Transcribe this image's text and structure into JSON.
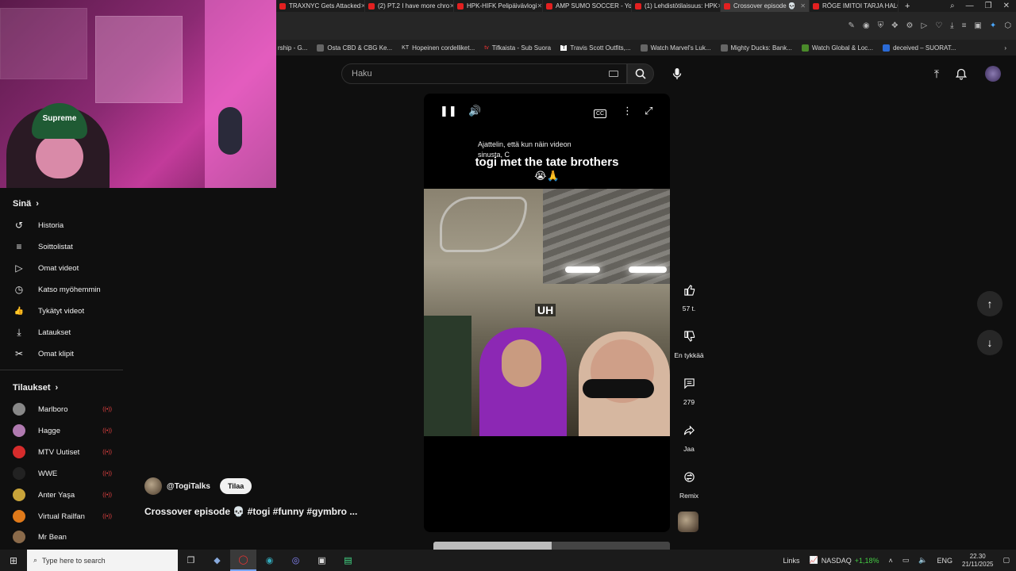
{
  "browser": {
    "tabs": [
      {
        "label": "TRAXNYC Gets Attacked",
        "active": false
      },
      {
        "label": "(2) PT.2 I have more chro",
        "active": false
      },
      {
        "label": "HPK-HIFK Pelipäivävlogi",
        "active": false
      },
      {
        "label": "AMP SUMO SOCCER - Yo",
        "active": false
      },
      {
        "label": "(1) Lehdistötilaisuus: HPK",
        "active": false
      },
      {
        "label": "Crossover episode 💀",
        "active": true
      },
      {
        "label": "RÖGE IMITOI TARJA HALO",
        "active": false
      }
    ],
    "bookmarks": [
      "rship - G...",
      "Osta CBD & CBG Ke...",
      "Hopeinen cordelliket...",
      "Tifkaista - Sub Suora",
      "Travis Scott Outfits,...",
      "Watch Marvel's Luk...",
      "Mighty Ducks: Bank...",
      "Watch Global & Loc...",
      "deceived – SUORAT..."
    ],
    "bookmark_prefixes": [
      "",
      "",
      "KT",
      "tv",
      "T",
      "",
      "",
      "",
      ""
    ]
  },
  "webcam": {
    "cap_text": "Supreme"
  },
  "header": {
    "search_placeholder": "Haku"
  },
  "sidebar": {
    "you_title": "Sinä",
    "you_items": [
      {
        "label": "Historia",
        "icon": "history-icon",
        "glyph": "↺"
      },
      {
        "label": "Soittolistat",
        "icon": "playlist-icon",
        "glyph": "≡"
      },
      {
        "label": "Omat videot",
        "icon": "my-videos-icon",
        "glyph": "▷"
      },
      {
        "label": "Katso myöhemmin",
        "icon": "watch-later-icon",
        "glyph": "◷"
      },
      {
        "label": "Tykätyt videot",
        "icon": "like-icon",
        "glyph": "👍"
      },
      {
        "label": "Lataukset",
        "icon": "download-icon",
        "glyph": "⤓"
      },
      {
        "label": "Omat klipit",
        "icon": "scissors-icon",
        "glyph": "✂"
      }
    ],
    "subs_title": "Tilaukset",
    "subscriptions": [
      {
        "label": "Marlboro",
        "color": "#888888"
      },
      {
        "label": "Hagge",
        "color": "#b07ab0"
      },
      {
        "label": "MTV Uutiset",
        "color": "#d62c2c"
      },
      {
        "label": "WWE",
        "color": "#222222"
      },
      {
        "label": "Anter Yaşa",
        "color": "#c9a43a"
      },
      {
        "label": "Virtual Railfan",
        "color": "#e07a1a"
      },
      {
        "label": "Mr Bean",
        "color": "#8a6a4a"
      }
    ],
    "live_glyph": "((•))"
  },
  "video": {
    "caption_small": "Ajattelin, että kun näin videon sinusta, C",
    "caption_title": "togi met the tate brothers",
    "caption_emoji": "😭🙏",
    "overlay_text": "UH",
    "cc_label": "CC"
  },
  "channel": {
    "handle": "@TogiTalks",
    "subscribe_label": "Tilaa",
    "title": "Crossover episode 💀 #togi #funny #gymbro ..."
  },
  "actions": {
    "likes": "57 t.",
    "dislike": "En tykkää",
    "comments": "279",
    "share": "Jaa",
    "remix": "Remix"
  },
  "taskbar": {
    "search_placeholder": "Type here to search",
    "links_label": "Links",
    "ticker_name": "NASDAQ",
    "ticker_change": "+1,18%",
    "lang": "ENG",
    "time": "22.30",
    "date": "21/11/2025"
  },
  "colors": {
    "accent_red": "#e32020",
    "live_red": "#ee4444",
    "ticker_green": "#44cc44"
  }
}
